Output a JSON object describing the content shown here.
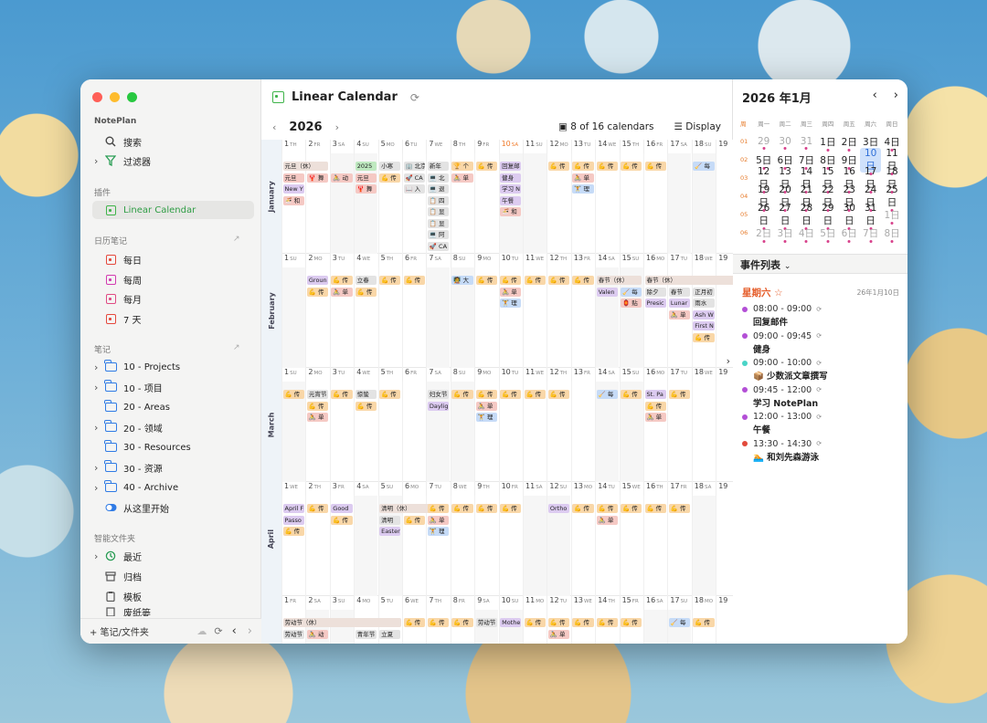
{
  "sidebar": {
    "app": "NotePlan",
    "search": "搜索",
    "filters": "过滤器",
    "plugins_header": "插件",
    "plugin_item": "Linear Calendar",
    "journal_header": "日历笔记",
    "daily": "每日",
    "weekly": "每周",
    "monthly": "每月",
    "seven": "7 天",
    "notes_header": "笔记",
    "folders": [
      "10 - Projects",
      "10 - 项目",
      "20 - Areas",
      "20 - 领域",
      "30 - Resources",
      "30 - 资源",
      "40 - Archive"
    ],
    "start_here": "从这里开始",
    "smart_header": "智能文件夹",
    "recent": "最近",
    "archive": "归档",
    "templates": "模板",
    "trash": "废纸篓",
    "footer": "+ 笔记/文件夹"
  },
  "header": {
    "title": "Linear Calendar",
    "year": "2026",
    "calendars": "8 of 16 calendars",
    "display": "Display"
  },
  "months": [
    {
      "name": "January",
      "days": [
        "1 TH",
        "2 FR",
        "3 SA",
        "4 SU",
        "5 MO",
        "6 TU",
        "7 WE",
        "8 TH",
        "9 FR",
        "10 SA",
        "11 SU",
        "12 MO",
        "13 TU",
        "14 WE",
        "15 TH",
        "16 FR",
        "17 SA",
        "18 SU",
        "19"
      ]
    },
    {
      "name": "February",
      "days": [
        "1 SU",
        "2 MO",
        "3 TU",
        "4 WE",
        "5 TH",
        "6 FR",
        "7 SA",
        "8 SU",
        "9 MO",
        "10 TU",
        "11 WE",
        "12 TH",
        "13 FR",
        "14 SA",
        "15 SU",
        "16 MO",
        "17 TU",
        "18 WE",
        "19"
      ]
    },
    {
      "name": "March",
      "days": [
        "1 SU",
        "2 MO",
        "3 TU",
        "4 WE",
        "5 TH",
        "6 FR",
        "7 SA",
        "8 SU",
        "9 MO",
        "10 TU",
        "11 WE",
        "12 TH",
        "13 FR",
        "14 SA",
        "15 SU",
        "16 MO",
        "17 TU",
        "18 WE",
        "19"
      ]
    },
    {
      "name": "April",
      "days": [
        "1 WE",
        "2 TH",
        "3 FR",
        "4 SA",
        "5 SU",
        "6 MO",
        "7 TU",
        "8 WE",
        "9 TH",
        "10 FR",
        "11 SA",
        "12 SU",
        "13 MO",
        "14 TU",
        "15 WE",
        "16 TH",
        "17 FR",
        "18 SA",
        "19"
      ]
    },
    {
      "name": "May",
      "days": [
        "1 FR",
        "2 SA",
        "3 SU",
        "4 MO",
        "5 TU",
        "6 WE",
        "7 TH",
        "8 FR",
        "9 SA",
        "10 SU",
        "11 MO",
        "12 TU",
        "13 WE",
        "14 TH",
        "15 FR",
        "16 SA",
        "17 SU",
        "18 MO",
        "19"
      ]
    }
  ],
  "events": [
    {
      "m": 0,
      "d": 0,
      "r": 0,
      "w": 2,
      "t": "元旦（休）",
      "c": "long"
    },
    {
      "m": 0,
      "d": 0,
      "r": 1,
      "w": 1,
      "t": "元旦",
      "c": "hol"
    },
    {
      "m": 0,
      "d": 0,
      "r": 2,
      "w": 1,
      "t": "New Y",
      "c": "ex"
    },
    {
      "m": 0,
      "d": 0,
      "r": 3,
      "w": 1,
      "t": "🍜 和",
      "c": "hol"
    },
    {
      "m": 0,
      "d": 1,
      "r": 1,
      "w": 1,
      "t": "🦞 舞",
      "c": "hol"
    },
    {
      "m": 0,
      "d": 2,
      "r": 1,
      "w": 1,
      "t": "🚴 动",
      "c": "hol"
    },
    {
      "m": 0,
      "d": 3,
      "r": 0,
      "w": 1,
      "t": "2025",
      "c": "gr"
    },
    {
      "m": 0,
      "d": 3,
      "r": 1,
      "w": 1,
      "t": "元旦",
      "c": "hol"
    },
    {
      "m": 0,
      "d": 3,
      "r": 2,
      "w": 1,
      "t": "🦞 舞",
      "c": "hol"
    },
    {
      "m": 0,
      "d": 4,
      "r": 0,
      "w": 1,
      "t": "小寒",
      "c": "gy"
    },
    {
      "m": 0,
      "d": 4,
      "r": 1,
      "w": 1,
      "t": "💪 传",
      "c": "sp"
    },
    {
      "m": 0,
      "d": 5,
      "r": 0,
      "w": 1,
      "t": "🏢 北京",
      "c": "gy"
    },
    {
      "m": 0,
      "d": 5,
      "r": 1,
      "w": 1,
      "t": "🚀 CA",
      "c": "gy"
    },
    {
      "m": 0,
      "d": 5,
      "r": 2,
      "w": 1,
      "t": "📖 入",
      "c": "gy"
    },
    {
      "m": 0,
      "d": 6,
      "r": 0,
      "w": 1,
      "t": "新年",
      "c": "gy"
    },
    {
      "m": 0,
      "d": 6,
      "r": 1,
      "w": 1,
      "t": "💻 北",
      "c": "gy"
    },
    {
      "m": 0,
      "d": 6,
      "r": 2,
      "w": 1,
      "t": "💻 退",
      "c": "gy"
    },
    {
      "m": 0,
      "d": 6,
      "r": 3,
      "w": 1,
      "t": "📋 四",
      "c": "gy"
    },
    {
      "m": 0,
      "d": 6,
      "r": 4,
      "w": 1,
      "t": "📋 显",
      "c": "gy"
    },
    {
      "m": 0,
      "d": 6,
      "r": 5,
      "w": 1,
      "t": "📋 显",
      "c": "gy"
    },
    {
      "m": 0,
      "d": 6,
      "r": 6,
      "w": 1,
      "t": "💻 阿",
      "c": "gy"
    },
    {
      "m": 0,
      "d": 6,
      "r": 7,
      "w": 1,
      "t": "🚀 CA",
      "c": "gy"
    },
    {
      "m": 0,
      "d": 7,
      "r": 0,
      "w": 1,
      "t": "🏆 个",
      "c": "sp"
    },
    {
      "m": 0,
      "d": 7,
      "r": 1,
      "w": 1,
      "t": "🚴 单",
      "c": "hol"
    },
    {
      "m": 0,
      "d": 8,
      "r": 0,
      "w": 1,
      "t": "💪 传",
      "c": "sp"
    },
    {
      "m": 0,
      "d": 9,
      "r": 0,
      "w": 1,
      "t": "回复邮",
      "c": "ex"
    },
    {
      "m": 0,
      "d": 9,
      "r": 1,
      "w": 1,
      "t": "健身",
      "c": "ex"
    },
    {
      "m": 0,
      "d": 9,
      "r": 2,
      "w": 1,
      "t": "学习 N",
      "c": "ex"
    },
    {
      "m": 0,
      "d": 9,
      "r": 3,
      "w": 1,
      "t": "午餐",
      "c": "ex"
    },
    {
      "m": 0,
      "d": 9,
      "r": 4,
      "w": 1,
      "t": "🍜 和",
      "c": "hol"
    },
    {
      "m": 0,
      "d": 11,
      "r": 0,
      "w": 1,
      "t": "💪 传",
      "c": "sp"
    },
    {
      "m": 0,
      "d": 12,
      "r": 0,
      "w": 1,
      "t": "💪 传",
      "c": "sp"
    },
    {
      "m": 0,
      "d": 12,
      "r": 1,
      "w": 1,
      "t": "🚴 单",
      "c": "hol"
    },
    {
      "m": 0,
      "d": 12,
      "r": 2,
      "w": 1,
      "t": "🏋 理",
      "c": "bl"
    },
    {
      "m": 0,
      "d": 13,
      "r": 0,
      "w": 1,
      "t": "💪 传",
      "c": "sp"
    },
    {
      "m": 0,
      "d": 14,
      "r": 0,
      "w": 1,
      "t": "💪 传",
      "c": "sp"
    },
    {
      "m": 0,
      "d": 15,
      "r": 0,
      "w": 1,
      "t": "💪 传",
      "c": "sp"
    },
    {
      "m": 0,
      "d": 17,
      "r": 0,
      "w": 1,
      "t": "🧹 每",
      "c": "bl"
    },
    {
      "m": 1,
      "d": 1,
      "r": 0,
      "w": 1,
      "t": "Groun",
      "c": "ex"
    },
    {
      "m": 1,
      "d": 1,
      "r": 1,
      "w": 1,
      "t": "💪 传",
      "c": "sp"
    },
    {
      "m": 1,
      "d": 2,
      "r": 0,
      "w": 1,
      "t": "💪 传",
      "c": "sp"
    },
    {
      "m": 1,
      "d": 2,
      "r": 1,
      "w": 1,
      "t": "🚴 单",
      "c": "hol"
    },
    {
      "m": 1,
      "d": 3,
      "r": 0,
      "w": 1,
      "t": "立春",
      "c": "gy"
    },
    {
      "m": 1,
      "d": 3,
      "r": 1,
      "w": 1,
      "t": "💪 传",
      "c": "sp"
    },
    {
      "m": 1,
      "d": 4,
      "r": 0,
      "w": 1,
      "t": "💪 传",
      "c": "sp"
    },
    {
      "m": 1,
      "d": 5,
      "r": 0,
      "w": 1,
      "t": "💪 传",
      "c": "sp"
    },
    {
      "m": 1,
      "d": 7,
      "r": 0,
      "w": 1,
      "t": "🧑‍🏫 大",
      "c": "bl"
    },
    {
      "m": 1,
      "d": 8,
      "r": 0,
      "w": 1,
      "t": "💪 传",
      "c": "sp"
    },
    {
      "m": 1,
      "d": 9,
      "r": 0,
      "w": 1,
      "t": "💪 传",
      "c": "sp"
    },
    {
      "m": 1,
      "d": 9,
      "r": 1,
      "w": 1,
      "t": "🚴 单",
      "c": "hol"
    },
    {
      "m": 1,
      "d": 9,
      "r": 2,
      "w": 1,
      "t": "🏋 理",
      "c": "bl"
    },
    {
      "m": 1,
      "d": 10,
      "r": 0,
      "w": 1,
      "t": "💪 传",
      "c": "sp"
    },
    {
      "m": 1,
      "d": 11,
      "r": 0,
      "w": 1,
      "t": "💪 传",
      "c": "sp"
    },
    {
      "m": 1,
      "d": 12,
      "r": 0,
      "w": 1,
      "t": "💪 传",
      "c": "sp"
    },
    {
      "m": 1,
      "d": 13,
      "r": 0,
      "w": 2,
      "t": "春节（休）",
      "c": "long"
    },
    {
      "m": 1,
      "d": 15,
      "r": 0,
      "w": 4,
      "t": "春节（休）",
      "c": "long"
    },
    {
      "m": 1,
      "d": 13,
      "r": 1,
      "w": 1,
      "t": "Valen",
      "c": "ex"
    },
    {
      "m": 1,
      "d": 14,
      "r": 1,
      "w": 1,
      "t": "🧹 每",
      "c": "bl"
    },
    {
      "m": 1,
      "d": 14,
      "r": 2,
      "w": 1,
      "t": "🏮 贴",
      "c": "hol"
    },
    {
      "m": 1,
      "d": 15,
      "r": 1,
      "w": 1,
      "t": "除夕",
      "c": "gy"
    },
    {
      "m": 1,
      "d": 15,
      "r": 2,
      "w": 1,
      "t": "Presic",
      "c": "ex"
    },
    {
      "m": 1,
      "d": 16,
      "r": 1,
      "w": 1,
      "t": "春节",
      "c": "gy"
    },
    {
      "m": 1,
      "d": 16,
      "r": 2,
      "w": 1,
      "t": "Lunar",
      "c": "ex"
    },
    {
      "m": 1,
      "d": 16,
      "r": 3,
      "w": 1,
      "t": "🚴 单",
      "c": "hol"
    },
    {
      "m": 1,
      "d": 17,
      "r": 1,
      "w": 1,
      "t": "正月初",
      "c": "gy"
    },
    {
      "m": 1,
      "d": 17,
      "r": 2,
      "w": 1,
      "t": "雨水",
      "c": "gy"
    },
    {
      "m": 1,
      "d": 17,
      "r": 3,
      "w": 1,
      "t": "Ash W",
      "c": "ex"
    },
    {
      "m": 1,
      "d": 17,
      "r": 4,
      "w": 1,
      "t": "First N",
      "c": "ex"
    },
    {
      "m": 1,
      "d": 17,
      "r": 5,
      "w": 1,
      "t": "💪 传",
      "c": "sp"
    },
    {
      "m": 2,
      "d": 0,
      "r": 0,
      "w": 1,
      "t": "💪 传",
      "c": "sp"
    },
    {
      "m": 2,
      "d": 1,
      "r": 0,
      "w": 1,
      "t": "元宵节",
      "c": "gy"
    },
    {
      "m": 2,
      "d": 1,
      "r": 1,
      "w": 1,
      "t": "💪 传",
      "c": "sp"
    },
    {
      "m": 2,
      "d": 1,
      "r": 2,
      "w": 1,
      "t": "🚴 单",
      "c": "hol"
    },
    {
      "m": 2,
      "d": 2,
      "r": 0,
      "w": 1,
      "t": "💪 传",
      "c": "sp"
    },
    {
      "m": 2,
      "d": 3,
      "r": 0,
      "w": 1,
      "t": "惊蛰",
      "c": "gy"
    },
    {
      "m": 2,
      "d": 3,
      "r": 1,
      "w": 1,
      "t": "💪 传",
      "c": "sp"
    },
    {
      "m": 2,
      "d": 4,
      "r": 0,
      "w": 1,
      "t": "💪 传",
      "c": "sp"
    },
    {
      "m": 2,
      "d": 6,
      "r": 0,
      "w": 1,
      "t": "妇女节",
      "c": "gy"
    },
    {
      "m": 2,
      "d": 6,
      "r": 1,
      "w": 1,
      "t": "Daylig",
      "c": "ex"
    },
    {
      "m": 2,
      "d": 7,
      "r": 0,
      "w": 1,
      "t": "💪 传",
      "c": "sp"
    },
    {
      "m": 2,
      "d": 8,
      "r": 0,
      "w": 1,
      "t": "💪 传",
      "c": "sp"
    },
    {
      "m": 2,
      "d": 8,
      "r": 1,
      "w": 1,
      "t": "🚴 单",
      "c": "hol"
    },
    {
      "m": 2,
      "d": 8,
      "r": 2,
      "w": 1,
      "t": "🏋 理",
      "c": "bl"
    },
    {
      "m": 2,
      "d": 9,
      "r": 0,
      "w": 1,
      "t": "💪 传",
      "c": "sp"
    },
    {
      "m": 2,
      "d": 10,
      "r": 0,
      "w": 1,
      "t": "💪 传",
      "c": "sp"
    },
    {
      "m": 2,
      "d": 11,
      "r": 0,
      "w": 1,
      "t": "💪 传",
      "c": "sp"
    },
    {
      "m": 2,
      "d": 13,
      "r": 0,
      "w": 1,
      "t": "🧹 每",
      "c": "bl"
    },
    {
      "m": 2,
      "d": 14,
      "r": 0,
      "w": 1,
      "t": "💪 传",
      "c": "sp"
    },
    {
      "m": 2,
      "d": 15,
      "r": 0,
      "w": 1,
      "t": "St. Pa",
      "c": "ex"
    },
    {
      "m": 2,
      "d": 15,
      "r": 1,
      "w": 1,
      "t": "💪 传",
      "c": "sp"
    },
    {
      "m": 2,
      "d": 15,
      "r": 2,
      "w": 1,
      "t": "🚴 单",
      "c": "hol"
    },
    {
      "m": 2,
      "d": 16,
      "r": 0,
      "w": 1,
      "t": "💪 传",
      "c": "sp"
    },
    {
      "m": 3,
      "d": 0,
      "r": 0,
      "w": 1,
      "t": "April F",
      "c": "ex"
    },
    {
      "m": 3,
      "d": 0,
      "r": 1,
      "w": 1,
      "t": "Passo",
      "c": "ex"
    },
    {
      "m": 3,
      "d": 0,
      "r": 2,
      "w": 1,
      "t": "💪 传",
      "c": "sp"
    },
    {
      "m": 3,
      "d": 1,
      "r": 0,
      "w": 1,
      "t": "💪 传",
      "c": "sp"
    },
    {
      "m": 3,
      "d": 2,
      "r": 0,
      "w": 1,
      "t": "Good",
      "c": "ex"
    },
    {
      "m": 3,
      "d": 2,
      "r": 1,
      "w": 1,
      "t": "💪 传",
      "c": "sp"
    },
    {
      "m": 3,
      "d": 4,
      "r": 0,
      "w": 3,
      "t": "清明（休）",
      "c": "long"
    },
    {
      "m": 3,
      "d": 4,
      "r": 1,
      "w": 1,
      "t": "清明",
      "c": "gy"
    },
    {
      "m": 3,
      "d": 4,
      "r": 2,
      "w": 1,
      "t": "Easter",
      "c": "ex"
    },
    {
      "m": 3,
      "d": 5,
      "r": 1,
      "w": 1,
      "t": "💪 传",
      "c": "sp"
    },
    {
      "m": 3,
      "d": 6,
      "r": 0,
      "w": 1,
      "t": "💪 传",
      "c": "sp"
    },
    {
      "m": 3,
      "d": 6,
      "r": 1,
      "w": 1,
      "t": "🚴 单",
      "c": "hol"
    },
    {
      "m": 3,
      "d": 6,
      "r": 2,
      "w": 1,
      "t": "🏋 理",
      "c": "bl"
    },
    {
      "m": 3,
      "d": 7,
      "r": 0,
      "w": 1,
      "t": "💪 传",
      "c": "sp"
    },
    {
      "m": 3,
      "d": 8,
      "r": 0,
      "w": 1,
      "t": "💪 传",
      "c": "sp"
    },
    {
      "m": 3,
      "d": 9,
      "r": 0,
      "w": 1,
      "t": "💪 传",
      "c": "sp"
    },
    {
      "m": 3,
      "d": 11,
      "r": 0,
      "w": 1,
      "t": "Ortho",
      "c": "ex"
    },
    {
      "m": 3,
      "d": 12,
      "r": 0,
      "w": 1,
      "t": "💪 传",
      "c": "sp"
    },
    {
      "m": 3,
      "d": 13,
      "r": 0,
      "w": 1,
      "t": "💪 传",
      "c": "sp"
    },
    {
      "m": 3,
      "d": 13,
      "r": 1,
      "w": 1,
      "t": "🚴 单",
      "c": "hol"
    },
    {
      "m": 3,
      "d": 14,
      "r": 0,
      "w": 1,
      "t": "💪 传",
      "c": "sp"
    },
    {
      "m": 3,
      "d": 15,
      "r": 0,
      "w": 1,
      "t": "💪 传",
      "c": "sp"
    },
    {
      "m": 3,
      "d": 16,
      "r": 0,
      "w": 1,
      "t": "💪 传",
      "c": "sp"
    },
    {
      "m": 4,
      "d": 0,
      "r": 0,
      "w": 5,
      "t": "劳动节（休）",
      "c": "long"
    },
    {
      "m": 4,
      "d": 0,
      "r": 1,
      "w": 1,
      "t": "劳动节",
      "c": "gy"
    },
    {
      "m": 4,
      "d": 1,
      "r": 1,
      "w": 1,
      "t": "🚴 动",
      "c": "hol"
    },
    {
      "m": 4,
      "d": 3,
      "r": 1,
      "w": 1,
      "t": "青年节",
      "c": "gy"
    },
    {
      "m": 4,
      "d": 4,
      "r": 1,
      "w": 1,
      "t": "立夏",
      "c": "gy"
    },
    {
      "m": 4,
      "d": 5,
      "r": 0,
      "w": 1,
      "t": "💪 传",
      "c": "sp"
    },
    {
      "m": 4,
      "d": 6,
      "r": 0,
      "w": 1,
      "t": "💪 传",
      "c": "sp"
    },
    {
      "m": 4,
      "d": 7,
      "r": 0,
      "w": 1,
      "t": "💪 传",
      "c": "sp"
    },
    {
      "m": 4,
      "d": 8,
      "r": 0,
      "w": 1,
      "t": "劳动节",
      "c": "gy"
    },
    {
      "m": 4,
      "d": 9,
      "r": 0,
      "w": 1,
      "t": "Mothe",
      "c": "ex"
    },
    {
      "m": 4,
      "d": 10,
      "r": 0,
      "w": 1,
      "t": "💪 传",
      "c": "sp"
    },
    {
      "m": 4,
      "d": 11,
      "r": 0,
      "w": 1,
      "t": "💪 传",
      "c": "sp"
    },
    {
      "m": 4,
      "d": 11,
      "r": 1,
      "w": 1,
      "t": "🚴 单",
      "c": "hol"
    },
    {
      "m": 4,
      "d": 12,
      "r": 0,
      "w": 1,
      "t": "💪 传",
      "c": "sp"
    },
    {
      "m": 4,
      "d": 13,
      "r": 0,
      "w": 1,
      "t": "💪 传",
      "c": "sp"
    },
    {
      "m": 4,
      "d": 14,
      "r": 0,
      "w": 1,
      "t": "💪 传",
      "c": "sp"
    },
    {
      "m": 4,
      "d": 16,
      "r": 0,
      "w": 1,
      "t": "🧹 每",
      "c": "bl"
    },
    {
      "m": 4,
      "d": 17,
      "r": 0,
      "w": 1,
      "t": "💪 传",
      "c": "sp"
    }
  ],
  "right": {
    "month_title": "2026 年1月",
    "weekdays": [
      "周",
      "周一",
      "周二",
      "周三",
      "周四",
      "周五",
      "周六",
      "周日"
    ],
    "weeks": [
      {
        "wk": "01",
        "days": [
          "29",
          "30",
          "31",
          "1日",
          "2日",
          "3日",
          "4日"
        ]
      },
      {
        "wk": "02",
        "days": [
          "5日",
          "6日",
          "7日",
          "8日",
          "9日",
          "10日",
          "11日"
        ]
      },
      {
        "wk": "03",
        "days": [
          "12日",
          "13日",
          "14日",
          "15日",
          "16日",
          "17日",
          "18日"
        ]
      },
      {
        "wk": "04",
        "days": [
          "19日",
          "20日",
          "21日",
          "22日",
          "23日",
          "24日",
          "25日"
        ]
      },
      {
        "wk": "05",
        "days": [
          "26日",
          "27日",
          "28日",
          "29日",
          "30日",
          "31日",
          "1日"
        ]
      },
      {
        "wk": "06",
        "days": [
          "2日",
          "3日",
          "4日",
          "5日",
          "6日",
          "7日",
          "8日"
        ]
      }
    ],
    "events_header": "事件列表",
    "day_label": "星期六 ☆",
    "day_date": "26年1月10日",
    "list": [
      {
        "time": "08:00 - 09:00",
        "name": "回复邮件",
        "color": "#b34fd6"
      },
      {
        "time": "09:00 - 09:45",
        "name": "健身",
        "color": "#b34fd6"
      },
      {
        "time": "09:00 - 10:00",
        "name": "📦 少数派文章撰写",
        "color": "#49d4c7"
      },
      {
        "time": "09:45 - 12:00",
        "name": "学习 NotePlan",
        "color": "#b34fd6"
      },
      {
        "time": "12:00 - 13:00",
        "name": "午餐",
        "color": "#b34fd6"
      },
      {
        "time": "13:30 - 14:30",
        "name": "🏊 和刘先森游泳",
        "color": "#e24a3b"
      }
    ]
  },
  "colors": {
    "accent": "#3fb44a",
    "today": "#f07a2a",
    "holiday": "#f5c9c4",
    "sport": "#f9d7a8",
    "event": "#dccbf0",
    "blue": "#c6dbf7"
  }
}
